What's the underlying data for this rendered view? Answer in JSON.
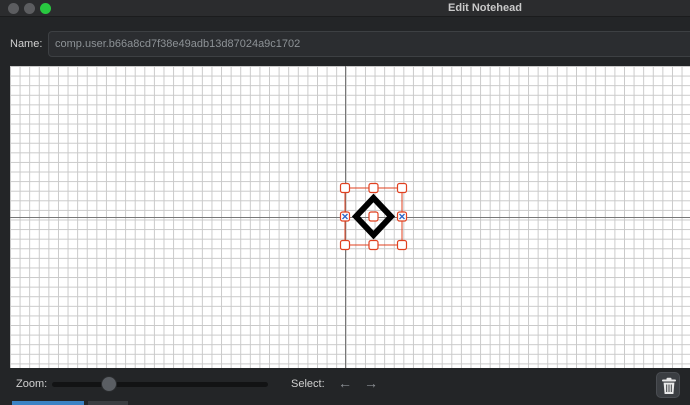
{
  "window": {
    "title": "Edit Notehead"
  },
  "name_field": {
    "label": "Name:",
    "value": "comp.user.b66a8cd7f38e49adb13d87024a9c1702"
  },
  "bottom_bar": {
    "zoom_label": "Zoom:",
    "select_label": "Select:",
    "select_prev_icon": "arrow-left-icon",
    "select_next_icon": "arrow-right-icon",
    "delete_icon": "trash-icon"
  },
  "colors": {
    "selection": "#e0401f",
    "handle_marker": "#2f68c9",
    "glyph": "#000000",
    "zoom_button": "#28c840"
  }
}
